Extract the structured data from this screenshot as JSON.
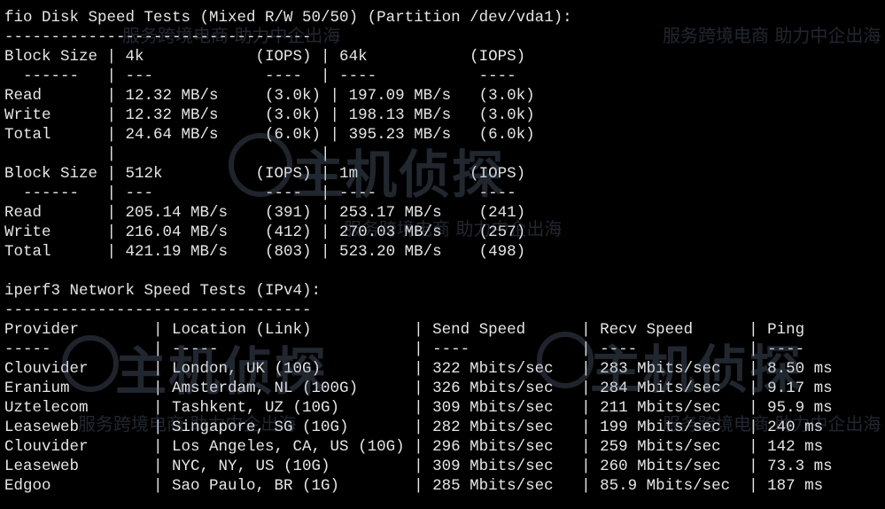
{
  "terminal": {
    "lines": [
      "fio Disk Speed Tests (Mixed R/W 50/50) (Partition /dev/vda1):",
      "---------------------------------",
      "Block Size | 4k            (IOPS) | 64k           (IOPS)",
      "  ------   | ---            ----  | ----           ----",
      "Read       | 12.32 MB/s     (3.0k) | 197.09 MB/s   (3.0k)",
      "Write      | 12.32 MB/s     (3.0k) | 198.13 MB/s   (3.0k)",
      "Total      | 24.64 MB/s     (6.0k) | 395.23 MB/s   (6.0k)",
      "           |                      |",
      "Block Size | 512k          (IOPS) | 1m            (IOPS)",
      "  ------   | ---            ----  | ----           ----",
      "Read       | 205.14 MB/s    (391) | 253.17 MB/s    (241)",
      "Write      | 216.04 MB/s    (412) | 270.03 MB/s    (257)",
      "Total      | 421.19 MB/s    (803) | 523.20 MB/s    (498)",
      "",
      "iperf3 Network Speed Tests (IPv4):",
      "---------------------------------",
      "Provider        | Location (Link)           | Send Speed      | Recv Speed      | Ping",
      "-----           | -----                     | ----            | ----            | ----",
      "Clouvider       | London, UK (10G)          | 322 Mbits/sec   | 283 Mbits/sec   | 8.50 ms",
      "Eranium         | Amsterdam, NL (100G)      | 326 Mbits/sec   | 284 Mbits/sec   | 9.17 ms",
      "Uztelecom       | Tashkent, UZ (10G)        | 309 Mbits/sec   | 211 Mbits/sec   | 95.9 ms",
      "Leaseweb        | Singapore, SG (10G)       | 282 Mbits/sec   | 199 Mbits/sec   | 240 ms",
      "Clouvider       | Los Angeles, CA, US (10G) | 296 Mbits/sec   | 259 Mbits/sec   | 142 ms",
      "Leaseweb        | NYC, NY, US (10G)         | 309 Mbits/sec   | 260 Mbits/sec   | 73.3 ms",
      "Edgoo           | Sao Paulo, BR (1G)        | 285 Mbits/sec   | 85.9 Mbits/sec  | 187 ms"
    ]
  },
  "watermark": {
    "brand": "主机侦探",
    "slogan": "服务跨境电商 助力中企出海"
  }
}
